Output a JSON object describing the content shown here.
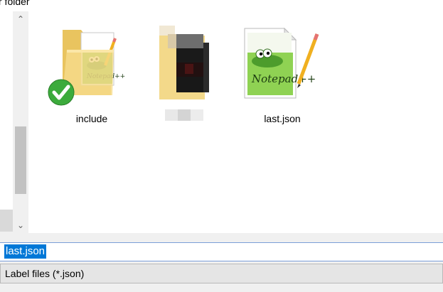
{
  "window": {
    "top_label": "r folder"
  },
  "files": [
    {
      "name": "include",
      "type": "folder-notepadpp",
      "status": "synced",
      "icon": "folder-icon"
    },
    {
      "name": "",
      "type": "folder-blurred",
      "icon": "folder-icon"
    },
    {
      "name": "last.json",
      "type": "notepadpp-file",
      "icon": "notepadpp-file-icon"
    }
  ],
  "filename_field": {
    "value": "last.json"
  },
  "filter": {
    "label": "Label files (*.json)"
  },
  "colors": {
    "selection": "#0078d7",
    "folder": "#f3d27a",
    "check": "#3cab3c",
    "pencil": "#f0b020"
  }
}
